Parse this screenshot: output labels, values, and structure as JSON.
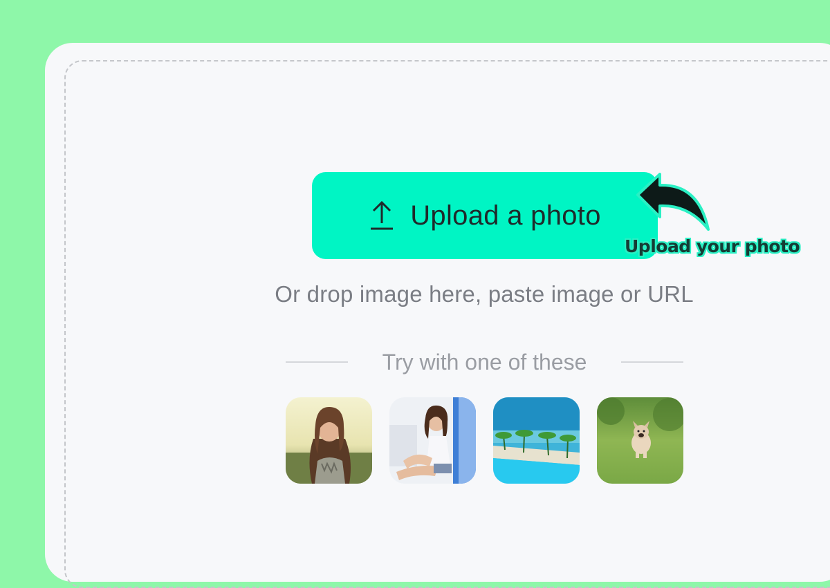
{
  "upload": {
    "button_label": "Upload a photo",
    "icon": "upload-icon",
    "drop_hint": "Or drop image here, paste image or URL"
  },
  "samples": {
    "heading": "Try with one of these",
    "items": [
      {
        "name": "sample-woman-field"
      },
      {
        "name": "sample-woman-sitting"
      },
      {
        "name": "sample-beach-pool"
      },
      {
        "name": "sample-dog-grass"
      }
    ]
  },
  "annotation": {
    "text": "Upload your photo",
    "arrow_icon": "curved-arrow-icon"
  },
  "colors": {
    "background": "#8ef7a9",
    "accent": "#00f5c4",
    "card": "#f7f8fa"
  }
}
